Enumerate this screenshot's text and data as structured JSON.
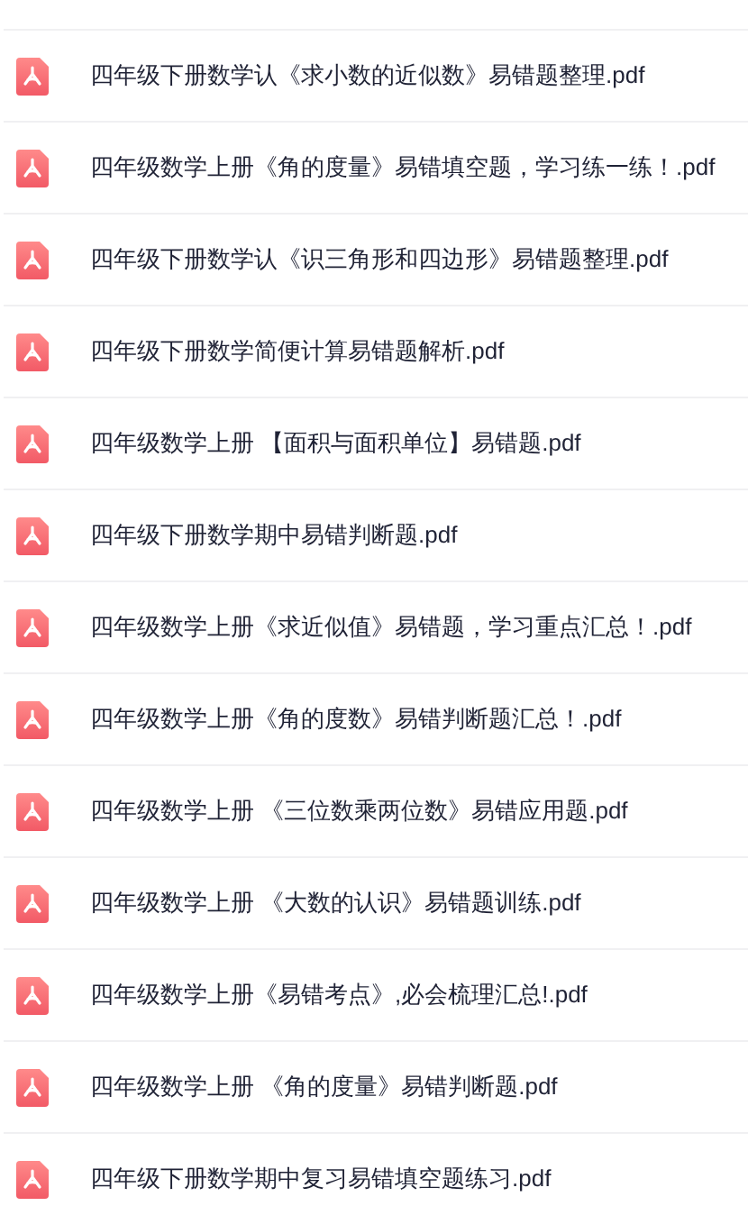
{
  "files": [
    {
      "name": "四年级下册数学认《求小数的近似数》易错题整理.pdf"
    },
    {
      "name": "四年级数学上册《角的度量》易错填空题，学习练一练！.pdf"
    },
    {
      "name": "四年级下册数学认《识三角形和四边形》易错题整理.pdf"
    },
    {
      "name": "四年级下册数学简便计算易错题解析.pdf"
    },
    {
      "name": "四年级数学上册 【面积与面积单位】易错题.pdf"
    },
    {
      "name": "四年级下册数学期中易错判断题.pdf"
    },
    {
      "name": "四年级数学上册《求近似值》易错题，学习重点汇总！.pdf"
    },
    {
      "name": "四年级数学上册《角的度数》易错判断题汇总！.pdf"
    },
    {
      "name": "四年级数学上册 《三位数乘两位数》易错应用题.pdf"
    },
    {
      "name": "四年级数学上册 《大数的认识》易错题训练.pdf"
    },
    {
      "name": "四年级数学上册《易错考点》,必会梳理汇总!.pdf"
    },
    {
      "name": "四年级数学上册 《角的度量》易错判断题.pdf"
    },
    {
      "name": "四年级下册数学期中复习易错填空题练习.pdf"
    }
  ]
}
